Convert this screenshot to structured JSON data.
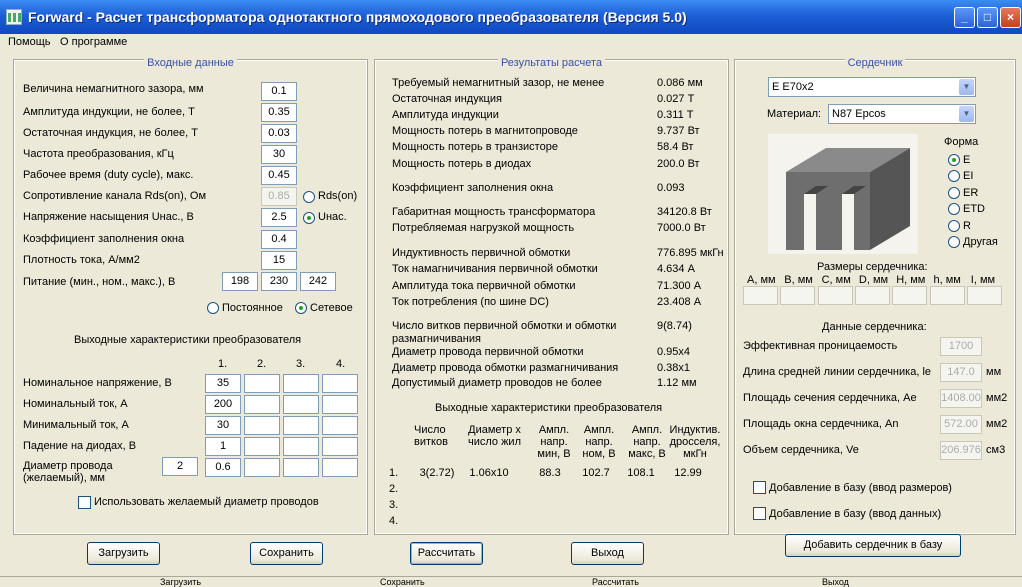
{
  "window": {
    "title": "Forward - Расчет трансформатора однотактного прямоходового преобразователя (Версия 5.0)",
    "min": "_",
    "max": "□",
    "close": "×"
  },
  "menu": [
    "Помощь",
    "О программе"
  ],
  "input": {
    "title": "Входные данные",
    "rows": [
      {
        "label": "Величина немагнитного зазора, мм",
        "value": "0.1"
      },
      {
        "label": "Амплитуда индукции, не более, Т",
        "value": "0.35"
      },
      {
        "label": "Остаточная индукция, не более, Т",
        "value": "0.03"
      },
      {
        "label": "Частота преобразования, кГц",
        "value": "30"
      },
      {
        "label": "Рабочее время (duty cycle), макс.",
        "value": "0.45"
      },
      {
        "label": "Сопротивление канала Rds(on), Ом",
        "value": "0.85"
      },
      {
        "label": "Напряжение насыщения Uнас., В",
        "value": "2.5"
      },
      {
        "label": "Коэффициент заполнения окна",
        "value": "0.4"
      },
      {
        "label": "Плотность тока, А/мм2",
        "value": "15"
      }
    ],
    "rds_radio": "Rds(on)",
    "unas_radio": "Uнас.",
    "power_label": "Питание (мин., ном., макс.), В",
    "power": [
      "198",
      "230",
      "242"
    ],
    "const_radio": "Постоянное",
    "net_radio": "Сетевое"
  },
  "outputs": {
    "title": "Выходные характеристики преобразователя",
    "cols": [
      "1.",
      "2.",
      "3.",
      "4."
    ],
    "rows": [
      {
        "label": "Номинальное напряжение, В",
        "values": [
          "35",
          "",
          "",
          ""
        ]
      },
      {
        "label": "Номинальный ток, А",
        "values": [
          "200",
          "",
          "",
          ""
        ]
      },
      {
        "label": "Минимальный ток, А",
        "values": [
          "30",
          "",
          "",
          ""
        ]
      },
      {
        "label": "Падение на диодах, В",
        "values": [
          "1",
          "",
          "",
          ""
        ]
      },
      {
        "label": "Диаметр провода (желаемый), мм",
        "values": [
          "0.6",
          "",
          "",
          ""
        ]
      }
    ],
    "wire_count": "2",
    "use_wire": "Использовать желаемый диаметр проводов"
  },
  "results": {
    "title": "Результаты расчета",
    "rows": [
      {
        "label": "Требуемый немагнитный зазор, не менее",
        "value": "0.086 мм"
      },
      {
        "label": "Остаточная индукция",
        "value": "0.027 Т"
      },
      {
        "label": "Амплитуда индукции",
        "value": "0.311 Т"
      },
      {
        "label": "Мощность потерь в магнитопроводе",
        "value": "9.737 Вт"
      },
      {
        "label": "Мощность потерь в транзисторе",
        "value": "58.4 Вт"
      },
      {
        "label": "Мощность потерь в диодах",
        "value": "200.0 Вт"
      },
      {
        "label": "Коэффициент заполнения окна",
        "value": "0.093"
      },
      {
        "label": "Габаритная мощность трансформатора",
        "value": "34120.8 Вт"
      },
      {
        "label": "Потребляемая нагрузкой мощность",
        "value": "7000.0 Вт"
      },
      {
        "label": "Индуктивность первичной обмотки",
        "value": "776.895 мкГн"
      },
      {
        "label": "Ток намагничивания первичной обмотки",
        "value": "4.634 А"
      },
      {
        "label": "Амплитуда тока первичной обмотки",
        "value": "71.300 А"
      },
      {
        "label": "Ток потребления (по шине DC)",
        "value": "23.408 А"
      },
      {
        "label": "Число витков первичной обмотки и обмотки размагничивания",
        "value": "9(8.74)"
      },
      {
        "label": "Диаметр провода первичной обмотки",
        "value": "0.95x4"
      },
      {
        "label": "Диаметр провода обмотки размагничивания",
        "value": "0.38x1"
      },
      {
        "label": "Допустимый диаметр проводов не более",
        "value": "1.12 мм"
      }
    ],
    "out_title": "Выходные характеристики преобразователя",
    "out_headers": [
      "Число витков",
      "Диаметр х число жил",
      "Ампл. напр. мин, В",
      "Ампл. напр. ном, В",
      "Ампл. напр. макс, В",
      "Индуктив. дросселя, мкГн"
    ],
    "out_rows": [
      {
        "n": "1.",
        "vals": [
          "3(2.72)",
          "1.06x10",
          "88.3",
          "102.7",
          "108.1",
          "12.99"
        ]
      },
      {
        "n": "2.",
        "vals": [
          "",
          "",
          "",
          "",
          "",
          ""
        ]
      },
      {
        "n": "3.",
        "vals": [
          "",
          "",
          "",
          "",
          "",
          ""
        ]
      },
      {
        "n": "4.",
        "vals": [
          "",
          "",
          "",
          "",
          "",
          ""
        ]
      }
    ]
  },
  "core": {
    "title": "Сердечник",
    "core_type": "E E70x2",
    "material_label": "Материал:",
    "material": "N87 Epcos",
    "form_label": "Форма",
    "forms": [
      "E",
      "EI",
      "ER",
      "ETD",
      "R",
      "Другая"
    ],
    "sizes_label": "Размеры сердечника:",
    "sizes": [
      "A, мм",
      "B, мм",
      "C, мм",
      "D, мм",
      "H, мм",
      "h, мм",
      "I, мм"
    ],
    "data_label": "Данные сердечника:",
    "data": [
      {
        "label": "Эффективная проницаемость",
        "value": "1700",
        "unit": ""
      },
      {
        "label": "Длина средней линии сердечника, le",
        "value": "147.0",
        "unit": "мм"
      },
      {
        "label": "Площадь сечения сердечника, Ae",
        "value": "1408.00",
        "unit": "мм2"
      },
      {
        "label": "Площадь окна сердечника, An",
        "value": "572.00",
        "unit": "мм2"
      },
      {
        "label": "Объем сердечника, Ve",
        "value": "206.976",
        "unit": "см3"
      }
    ],
    "add_sizes": "Добавление в базу (ввод размеров)",
    "add_data": "Добавление в базу (ввод данных)",
    "add_core": "Добавить сердечник в базу"
  },
  "buttons": {
    "load": "Загрузить",
    "save": "Сохранить",
    "calc": "Рассчитать",
    "exit": "Выход"
  },
  "taskbar": [
    "Загрузить",
    "Сохранить",
    "Рассчитать",
    "Выход"
  ]
}
